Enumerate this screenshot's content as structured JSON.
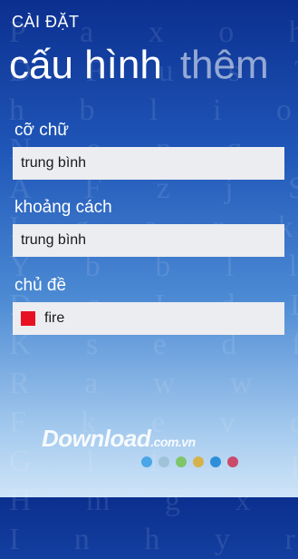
{
  "app": {
    "title": "CÀI ĐẶT"
  },
  "pivot": {
    "active": "cấu hình",
    "next": "thêm"
  },
  "settings": {
    "font_size": {
      "label": "cỡ chữ",
      "value": "trung bình"
    },
    "spacing": {
      "label": "khoảng cách",
      "value": "trung bình"
    },
    "theme": {
      "label": "chủ đề",
      "value": "fire",
      "swatch_color": "#e81123"
    }
  },
  "background_letters": [
    "P a x o h Y",
    "D F u s T a",
    "h b l i o p",
    "N o p q r s",
    "A F z j S T",
    "I g a r k B",
    "Y b b l l C",
    "D c I d L D",
    "K s e d f E",
    "R a w w q F",
    "F k e v o F",
    "G l f w p G",
    "H m g x q H",
    "I n h y r I"
  ],
  "watermark": {
    "text": "Download",
    "domain": ".com.vn",
    "dot_colors": [
      "#4aa6e6",
      "#9fc2d8",
      "#7fc66b",
      "#d6b24a",
      "#2e8fd9",
      "#c94a6a"
    ]
  }
}
